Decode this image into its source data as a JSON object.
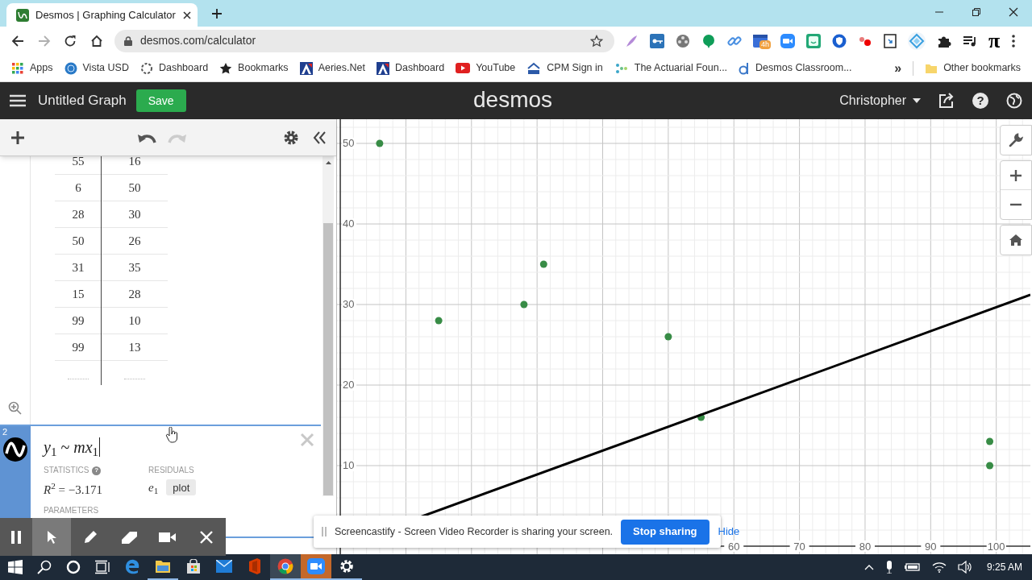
{
  "browser": {
    "tab_title": "Desmos | Graphing Calculator",
    "nav": {
      "back_disabled": false,
      "forward_disabled": true
    },
    "url": "desmos.com/calculator",
    "calendar_badge": "4h",
    "pi_extension": "π",
    "bookmarks": [
      {
        "kind": "apps",
        "label": "Apps"
      },
      {
        "kind": "globe",
        "label": "Vista USD"
      },
      {
        "kind": "ring",
        "label": "Dashboard"
      },
      {
        "kind": "star",
        "label": "Bookmarks"
      },
      {
        "kind": "triangle",
        "label": "Aeries.Net"
      },
      {
        "kind": "triangle",
        "label": "Dashboard"
      },
      {
        "kind": "play",
        "label": "YouTube"
      },
      {
        "kind": "cpm",
        "label": "CPM Sign in"
      },
      {
        "kind": "dots",
        "label": "The Actuarial Foun..."
      },
      {
        "kind": "ring-bar",
        "label": "Desmos Classroom..."
      }
    ],
    "overflow": "»",
    "other_bookmarks": "Other bookmarks"
  },
  "app_header": {
    "title": "Untitled Graph",
    "save": "Save",
    "logo": "desmos",
    "user": "Christopher",
    "help": "?"
  },
  "expression_toolbar": {
    "undo": {
      "disabled": false
    },
    "redo": {
      "disabled": true
    }
  },
  "table": {
    "rows": [
      [
        "55",
        "16"
      ],
      [
        "6",
        "50"
      ],
      [
        "28",
        "30"
      ],
      [
        "50",
        "26"
      ],
      [
        "31",
        "35"
      ],
      [
        "15",
        "28"
      ],
      [
        "99",
        "10"
      ],
      [
        "99",
        "13"
      ]
    ]
  },
  "expression_2": {
    "number": "2",
    "selected": true,
    "formula": "*y*$_{1}$ ~ *mx*$_{1}$",
    "statistics_label": "STATISTICS",
    "statistics_help": "?",
    "r_squared": "*R*$^{2}$ = −3.171",
    "residuals_label": "RESIDUALS",
    "residual_var": "*e*$_{1}$",
    "plot_button": "plot",
    "parameters_label": "PARAMETERS"
  },
  "graph": {
    "chart_data": {
      "type": "scatter",
      "grid": true,
      "x": [
        55,
        6,
        28,
        50,
        31,
        15,
        99,
        99
      ],
      "series": [
        {
          "color": "#388c46",
          "values": [
            16,
            50,
            30,
            26,
            35,
            28,
            10,
            13
          ]
        }
      ],
      "xlim": [
        -0.5,
        105.2
      ],
      "ylim": [
        -1,
        53
      ],
      "xticks": [
        60,
        70,
        80,
        90,
        100
      ],
      "yticks": [
        10,
        20,
        30,
        40,
        50
      ]
    }
  },
  "recorder_toolbar": [
    {
      "kind": "pause",
      "selected": false
    },
    {
      "kind": "pointer",
      "selected": true
    },
    {
      "kind": "pen",
      "selected": false
    },
    {
      "kind": "eraser",
      "selected": false
    },
    {
      "kind": "camera",
      "selected": false
    },
    {
      "kind": "close",
      "selected": false
    }
  ],
  "sharing_bar": {
    "message": "Screencastify - Screen Video Recorder is sharing your screen.",
    "stop": "Stop sharing",
    "hide": "Hide"
  },
  "taskbar": {
    "apps": [
      {
        "kind": "edge",
        "running": false,
        "selected": false,
        "flashing": false
      },
      {
        "kind": "folder",
        "running": true,
        "selected": false,
        "flashing": false
      },
      {
        "kind": "store",
        "running": false,
        "selected": false,
        "flashing": false
      },
      {
        "kind": "mail",
        "running": false,
        "selected": false,
        "flashing": false
      },
      {
        "kind": "office",
        "running": false,
        "selected": false,
        "flashing": false
      },
      {
        "kind": "chrome",
        "running": true,
        "selected": true,
        "flashing": false
      },
      {
        "kind": "video",
        "running": true,
        "selected": false,
        "flashing": true
      },
      {
        "kind": "gear",
        "running": true,
        "selected": false,
        "flashing": false
      }
    ],
    "time": "9:25 AM"
  }
}
